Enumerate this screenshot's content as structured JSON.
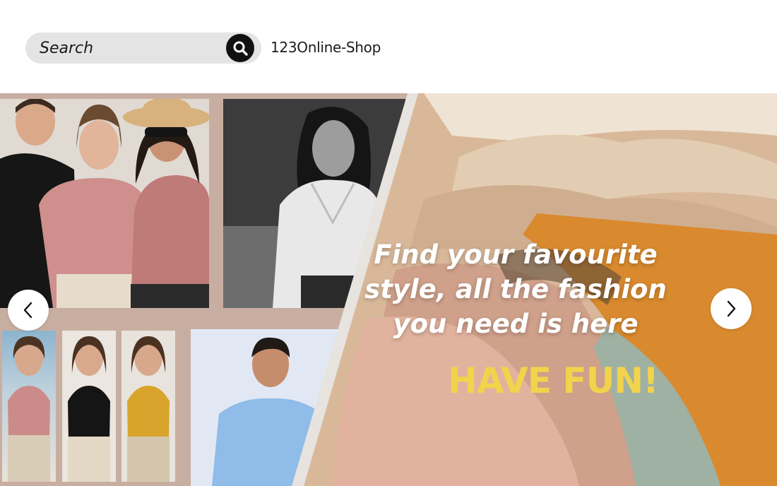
{
  "search": {
    "placeholder": "Search",
    "icon": "search-icon"
  },
  "shop": {
    "name": "123Online-Shop"
  },
  "banner": {
    "headline_lines": [
      "Find your favourite",
      "style, all the fashion",
      "you need is here"
    ],
    "cta": "HAVE FUN!",
    "cta_color": "#f2d34c",
    "prev_icon": "chevron-left-icon",
    "next_icon": "chevron-right-icon"
  }
}
